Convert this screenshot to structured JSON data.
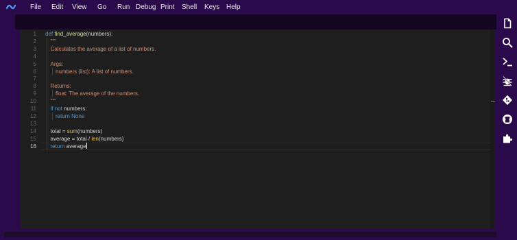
{
  "menubar": {
    "logo_icon": "tilde-logo-icon",
    "items": [
      "File",
      "Edit",
      "View",
      "Go",
      "Run",
      "Debug",
      "Print",
      "Shell",
      "Keys",
      "Help"
    ]
  },
  "editor": {
    "language": "python",
    "active_line": 16,
    "lines": [
      {
        "num": "1",
        "parts": [
          [
            "k",
            "def "
          ],
          [
            "f",
            "find_average"
          ],
          [
            "p",
            "(numbers):"
          ]
        ]
      },
      {
        "num": "2",
        "parts": [
          [
            "s",
            "\"\"\""
          ]
        ]
      },
      {
        "num": "3",
        "parts": [
          [
            "s",
            "Calculates the average of a list of numbers."
          ]
        ]
      },
      {
        "num": "4",
        "parts": []
      },
      {
        "num": "5",
        "parts": [
          [
            "s",
            "Args:"
          ]
        ]
      },
      {
        "num": "6",
        "parts": [
          [
            "s",
            "numbers (list): A list of numbers."
          ]
        ]
      },
      {
        "num": "7",
        "parts": []
      },
      {
        "num": "8",
        "parts": [
          [
            "s",
            "Returns:"
          ]
        ]
      },
      {
        "num": "9",
        "parts": [
          [
            "s",
            "float: The average of the numbers."
          ]
        ]
      },
      {
        "num": "10",
        "parts": [
          [
            "s",
            "\"\"\""
          ]
        ]
      },
      {
        "num": "11",
        "parts": [
          [
            "k",
            "if not "
          ],
          [
            "p",
            "numbers:"
          ]
        ]
      },
      {
        "num": "12",
        "parts": [
          [
            "k",
            "return None"
          ]
        ]
      },
      {
        "num": "13",
        "parts": []
      },
      {
        "num": "14",
        "parts": [
          [
            "p",
            "total = "
          ],
          [
            "fn",
            "sum"
          ],
          [
            "p",
            "(numbers)"
          ]
        ]
      },
      {
        "num": "15",
        "parts": [
          [
            "p",
            "average = total / "
          ],
          [
            "fn",
            "len"
          ],
          [
            "p",
            "(numbers)"
          ]
        ]
      },
      {
        "num": "16",
        "parts": [
          [
            "k",
            "return "
          ],
          [
            "p",
            "average"
          ]
        ]
      }
    ]
  },
  "sidebar": {
    "icons": [
      "file-icon",
      "search-icon",
      "terminal-icon",
      "debug-icon",
      "git-icon",
      "github-icon",
      "extensions-icon"
    ]
  },
  "colors": {
    "chrome": "#2a0a4a",
    "editor_bg": "#1e1e1e",
    "keyword": "#569cd6",
    "string": "#ce9178",
    "function": "#dcdcaa"
  }
}
